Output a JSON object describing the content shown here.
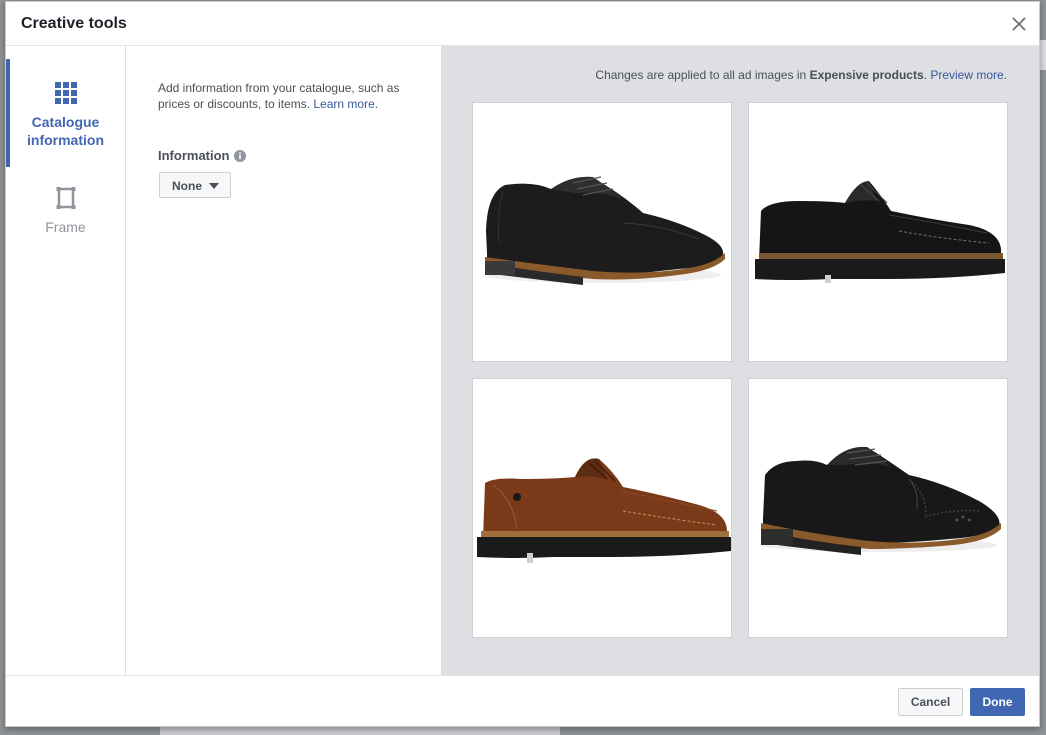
{
  "dialog": {
    "title": "Creative tools",
    "close_icon": "close-icon"
  },
  "sidebar": {
    "items": [
      {
        "label": "Catalogue information",
        "icon": "grid-icon",
        "active": true
      },
      {
        "label": "Frame",
        "icon": "frame-icon",
        "active": false
      }
    ]
  },
  "settings": {
    "description": "Add information from your catalogue, such as prices or discounts, to items.",
    "learn_more": "Learn more.",
    "information_label": "Information",
    "information_icon": "info-icon",
    "dropdown_value": "None"
  },
  "preview": {
    "note_prefix": "Changes are applied to all ad images in",
    "note_set_name": "Expensive products",
    "note_link": "Preview more.",
    "images": [
      {
        "name": "black-cap-toe-shoe",
        "colour": "#1b1b1b",
        "sole": "#2a2a2a",
        "welt": "#8b5a2b"
      },
      {
        "name": "black-moccasin-shoe",
        "colour": "#141414",
        "sole": "#1a1a1a",
        "welt": "#7a5633"
      },
      {
        "name": "brown-moccasin-shoe",
        "colour": "#7a3a1a",
        "sole": "#1a1a1a",
        "welt": "#a0703c"
      },
      {
        "name": "black-brogue-shoe",
        "colour": "#181818",
        "sole": "#222222",
        "welt": "#8b5a2b"
      }
    ]
  },
  "footer": {
    "cancel_label": "Cancel",
    "done_label": "Done"
  },
  "colors": {
    "accent": "#4267b2",
    "link": "#365899",
    "preview_bg": "#dddfe3"
  }
}
